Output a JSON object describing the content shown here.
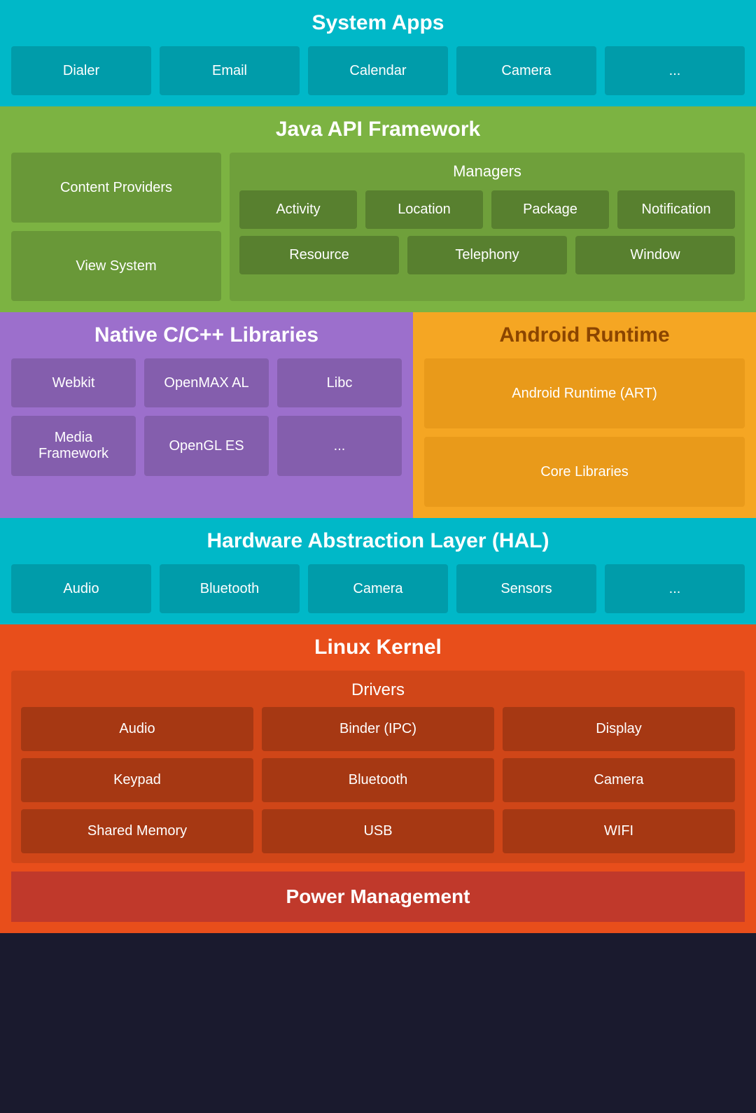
{
  "system_apps": {
    "title": "System Apps",
    "apps": [
      "Dialer",
      "Email",
      "Calendar",
      "Camera",
      "..."
    ]
  },
  "java_api": {
    "title": "Java API Framework",
    "left": {
      "items": [
        "Content Providers",
        "View System"
      ]
    },
    "managers": {
      "title": "Managers",
      "row1": [
        "Activity",
        "Location",
        "Package",
        "Notification"
      ],
      "row2": [
        "Resource",
        "Telephony",
        "Window"
      ]
    }
  },
  "native": {
    "title": "Native C/C++ Libraries",
    "row1": [
      "Webkit",
      "OpenMAX AL",
      "Libc"
    ],
    "row2": [
      "Media Framework",
      "OpenGL ES",
      "..."
    ]
  },
  "runtime": {
    "title": "Android Runtime",
    "items": [
      "Android Runtime (ART)",
      "Core Libraries"
    ]
  },
  "hal": {
    "title": "Hardware Abstraction Layer (HAL)",
    "items": [
      "Audio",
      "Bluetooth",
      "Camera",
      "Sensors",
      "..."
    ]
  },
  "kernel": {
    "title": "Linux Kernel",
    "drivers_title": "Drivers",
    "drivers_row1": [
      "Audio",
      "Binder (IPC)",
      "Display"
    ],
    "drivers_row2": [
      "Keypad",
      "Bluetooth",
      "Camera"
    ],
    "drivers_row3": [
      "Shared Memory",
      "USB",
      "WIFI"
    ],
    "power": "Power Management"
  }
}
